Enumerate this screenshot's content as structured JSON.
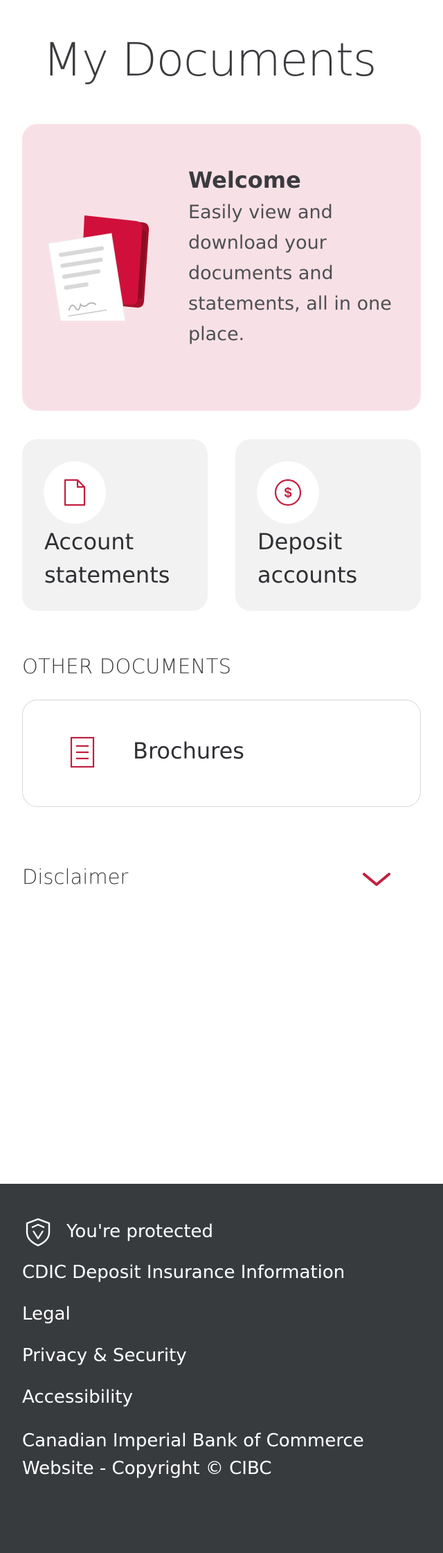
{
  "page": {
    "title": "My Documents"
  },
  "welcome": {
    "title": "Welcome",
    "body": "Easily view and download your documents and statements, all in one place."
  },
  "tiles": [
    {
      "label": "Account statements",
      "icon": "document-icon"
    },
    {
      "label": "Deposit accounts",
      "icon": "dollar-circle-icon"
    }
  ],
  "other_documents": {
    "heading": "OTHER DOCUMENTS",
    "items": [
      {
        "label": "Brochures",
        "icon": "brochure-icon"
      }
    ]
  },
  "disclaimer": {
    "label": "Disclaimer",
    "icon": "chevron-down-icon"
  },
  "footer": {
    "protected_label": "You're protected",
    "protected_icon": "shield-icon",
    "links": [
      "CDIC Deposit Insurance Information",
      "Legal",
      "Privacy & Security",
      "Accessibility"
    ],
    "copyright": "Canadian Imperial Bank of Commerce Website - Copyright © CIBC"
  },
  "colors": {
    "brand_red": "#c41f3e",
    "welcome_bg": "#f8e1e6",
    "tile_bg": "#f2f2f2",
    "footer_bg": "#383b3e"
  }
}
